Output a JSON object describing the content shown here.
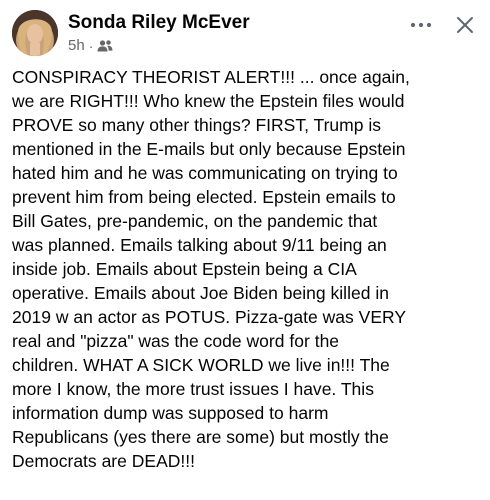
{
  "post": {
    "author": "Sonda Riley McEver",
    "time": "5h",
    "separator": "·",
    "audience_icon": "friends-icon",
    "more_icon": "ellipsis-icon",
    "close_icon": "close-icon",
    "text": "CONSPIRACY THEORIST ALERT!!! ... once again,\nwe are RIGHT!!! Who knew the Epstein files would\nPROVE so many other things? FIRST, Trump is\nmentioned in the E-mails but only because Epstein\nhated him and he was communicating on trying to\nprevent him from being elected. Epstein emails to\nBill Gates, pre-pandemic, on the pandemic that\nwas planned. Emails talking about 9/11 being an\ninside job. Emails about Epstein being a CIA\noperative. Emails about Joe Biden being killed in\n2019 w an actor as POTUS. Pizza-gate was VERY\nreal and \"pizza\" was the code word for the\nchildren. WHAT A SICK WORLD we live in!!! The\nmore I know, the more trust issues I have. This\ninformation dump was supposed to harm\nRepublicans (yes there are some) but mostly the\nDemocrats are DEAD!!!"
  },
  "colors": {
    "text": "#050505",
    "secondary": "#65676b",
    "background": "#ffffff"
  }
}
